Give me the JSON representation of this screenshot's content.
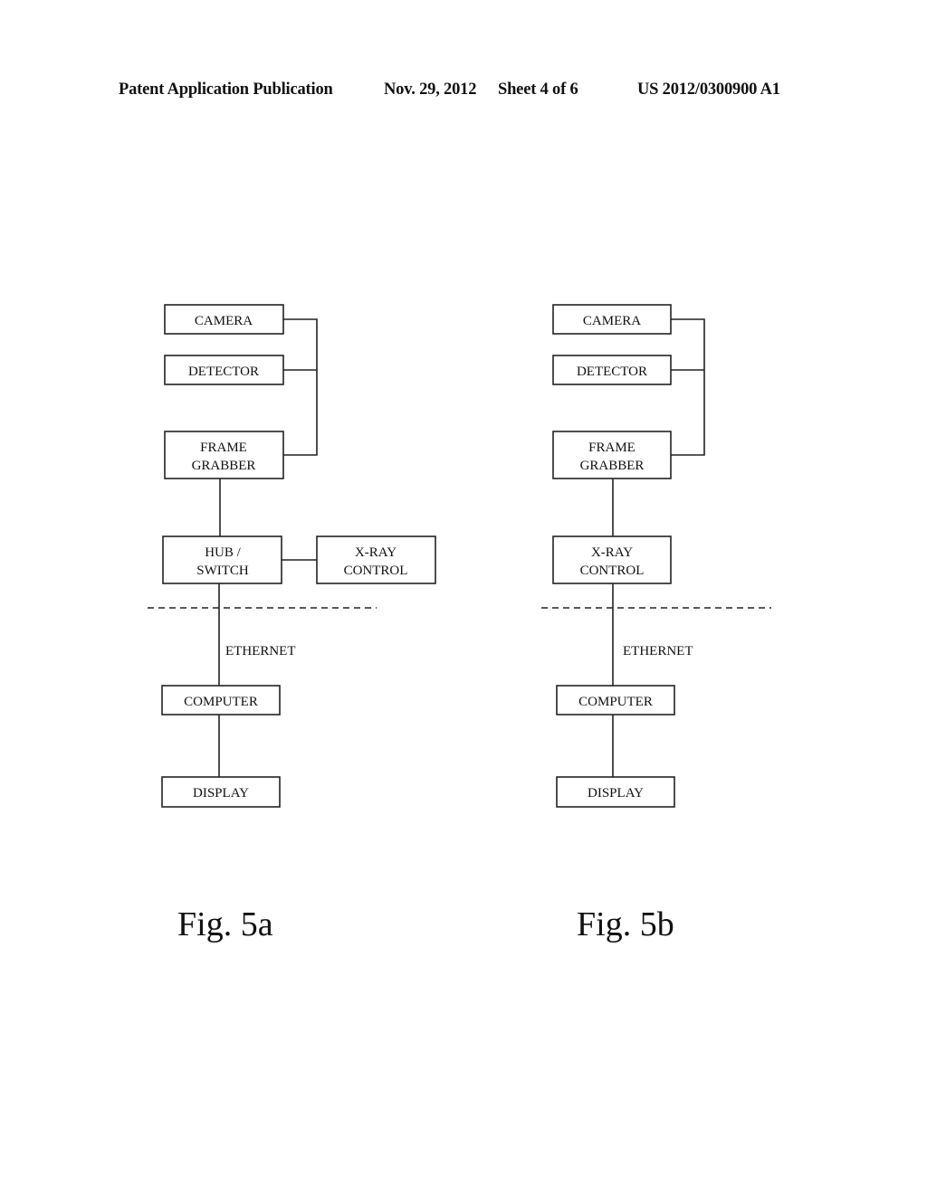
{
  "header": {
    "publication": "Patent Application Publication",
    "date": "Nov. 29, 2012",
    "sheet": "Sheet 4 of 6",
    "number": "US 2012/0300900 A1"
  },
  "figures": [
    {
      "caption": "Fig. 5a",
      "blocks": {
        "camera": [
          "CAMERA"
        ],
        "detector": [
          "DETECTOR"
        ],
        "frame_grabber": [
          "FRAME",
          "GRABBER"
        ],
        "hub_switch": [
          "HUB /",
          "SWITCH"
        ],
        "xray_control": [
          "X-RAY",
          "CONTROL"
        ],
        "computer": [
          "COMPUTER"
        ],
        "display": [
          "DISPLAY"
        ]
      },
      "link_label": "ETHERNET"
    },
    {
      "caption": "Fig. 5b",
      "blocks": {
        "camera": [
          "CAMERA"
        ],
        "detector": [
          "DETECTOR"
        ],
        "frame_grabber": [
          "FRAME",
          "GRABBER"
        ],
        "xray_control": [
          "X-RAY",
          "CONTROL"
        ],
        "computer": [
          "COMPUTER"
        ],
        "display": [
          "DISPLAY"
        ]
      },
      "link_label": "ETHERNET"
    }
  ]
}
